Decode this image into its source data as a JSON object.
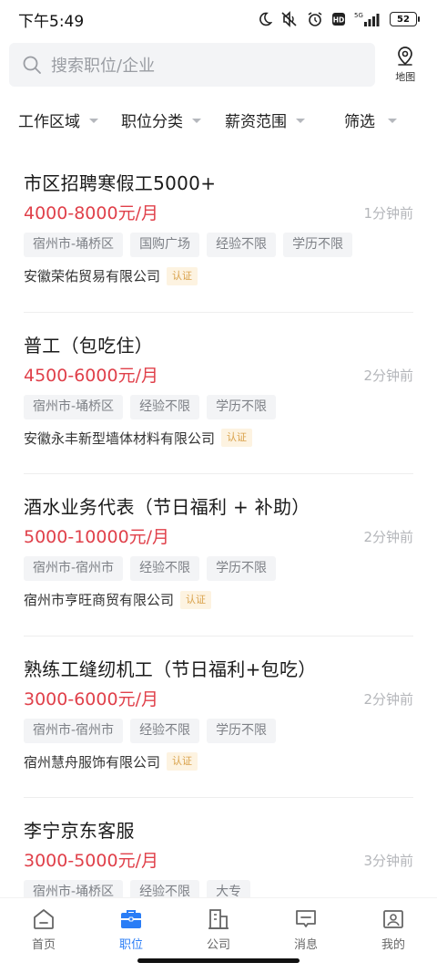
{
  "status_bar": {
    "time": "下午5:49",
    "network": "5G",
    "battery": "52"
  },
  "search": {
    "placeholder": "搜索职位/企业",
    "map_label": "地图"
  },
  "filters": [
    {
      "label": "工作区域"
    },
    {
      "label": "职位分类"
    },
    {
      "label": "薪资范围"
    },
    {
      "label": "筛选"
    }
  ],
  "jobs": [
    {
      "title": "市区招聘寒假工5000+",
      "salary": "4000-8000元/月",
      "time": "1分钟前",
      "tags": [
        "宿州市-埇桥区",
        "国购广场",
        "经验不限",
        "学历不限"
      ],
      "company": "安徽荣佑贸易有限公司",
      "badge": "认证"
    },
    {
      "title": "普工（包吃住）",
      "salary": "4500-6000元/月",
      "time": "2分钟前",
      "tags": [
        "宿州市-埇桥区",
        "经验不限",
        "学历不限"
      ],
      "company": "安徽永丰新型墙体材料有限公司",
      "badge": "认证"
    },
    {
      "title": "酒水业务代表（节日福利 + 补助）",
      "salary": "5000-10000元/月",
      "time": "2分钟前",
      "tags": [
        "宿州市-宿州市",
        "经验不限",
        "学历不限"
      ],
      "company": "宿州市亨旺商贸有限公司",
      "badge": "认证"
    },
    {
      "title": "熟练工缝纫机工（节日福利+包吃）",
      "salary": "3000-6000元/月",
      "time": "2分钟前",
      "tags": [
        "宿州市-宿州市",
        "经验不限",
        "学历不限"
      ],
      "company": "宿州慧舟服饰有限公司",
      "badge": "认证"
    },
    {
      "title": "李宁京东客服",
      "salary": "3000-5000元/月",
      "time": "3分钟前",
      "tags": [
        "宿州市-埇桥区",
        "经验不限",
        "大专"
      ],
      "company": "",
      "badge": ""
    }
  ],
  "bottom_nav": [
    {
      "label": "首页",
      "icon": "home-icon"
    },
    {
      "label": "职位",
      "icon": "briefcase-icon",
      "active": true
    },
    {
      "label": "公司",
      "icon": "building-icon"
    },
    {
      "label": "消息",
      "icon": "message-icon"
    },
    {
      "label": "我的",
      "icon": "profile-icon"
    }
  ],
  "colors": {
    "accent": "#2a7df6",
    "salary": "#e0404a",
    "tag_bg": "#f3f4f6",
    "badge_text": "#d9a14a",
    "badge_bg": "#fdf3e1"
  }
}
